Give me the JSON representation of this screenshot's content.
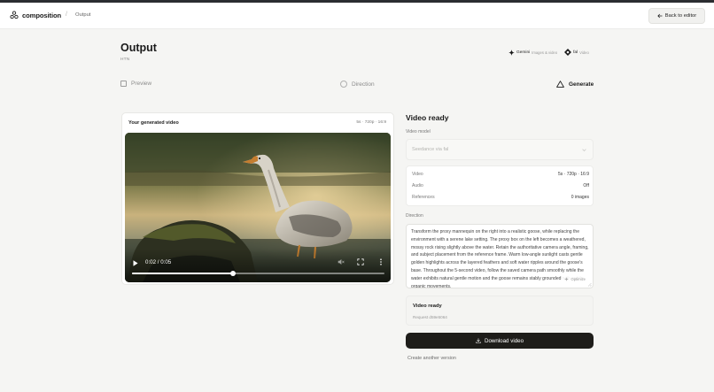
{
  "app": {
    "brand": "composition",
    "breadcrumb": "Output",
    "back_label": "Back to editor"
  },
  "page": {
    "title": "Output",
    "subtitle": "HTN"
  },
  "providers": [
    {
      "name": "Gemini",
      "desc": "Images & video",
      "icon": "diamond-sparkle-icon"
    },
    {
      "name": "fal",
      "desc": "Video",
      "icon": "fal-logo-icon"
    }
  ],
  "steps": {
    "preview": "Preview",
    "direction": "Direction",
    "generate": "Generate"
  },
  "video_card": {
    "title": "Your generated video",
    "meta": "5s · 720p · 16:9",
    "time": "0:02 / 0:05",
    "progress": 0.4
  },
  "panel": {
    "title": "Video ready",
    "model_label": "Video model",
    "model_value": "Seedance via fal",
    "summary": [
      {
        "k": "Video",
        "v": "5s · 720p · 16:9"
      },
      {
        "k": "Audio",
        "v": "Off"
      },
      {
        "k": "References",
        "v": "0 images"
      }
    ],
    "direction_label": "Direction",
    "direction_text": "Transform the proxy mannequin on the right into a realistic goose, while replacing the environment with a serene lake setting. The proxy box on the left becomes a weathered, mossy rock rising slightly above the water. Retain the authoritative camera angle, framing, and subject placement from the reference frame. Warm low-angle sunlight casts gentle golden highlights across the layered feathers and soft water ripples around the goose's base. Throughout the 5-second video, follow the saved camera path smoothly while the water exhibits natural gentle motion and the goose remains stably grounded with subtle organic movements.",
    "optimize_label": "Optimize",
    "status_title": "Video ready",
    "status_sub": "Request d59e5064",
    "download_label": "Download video",
    "create_label": "Create another version"
  }
}
